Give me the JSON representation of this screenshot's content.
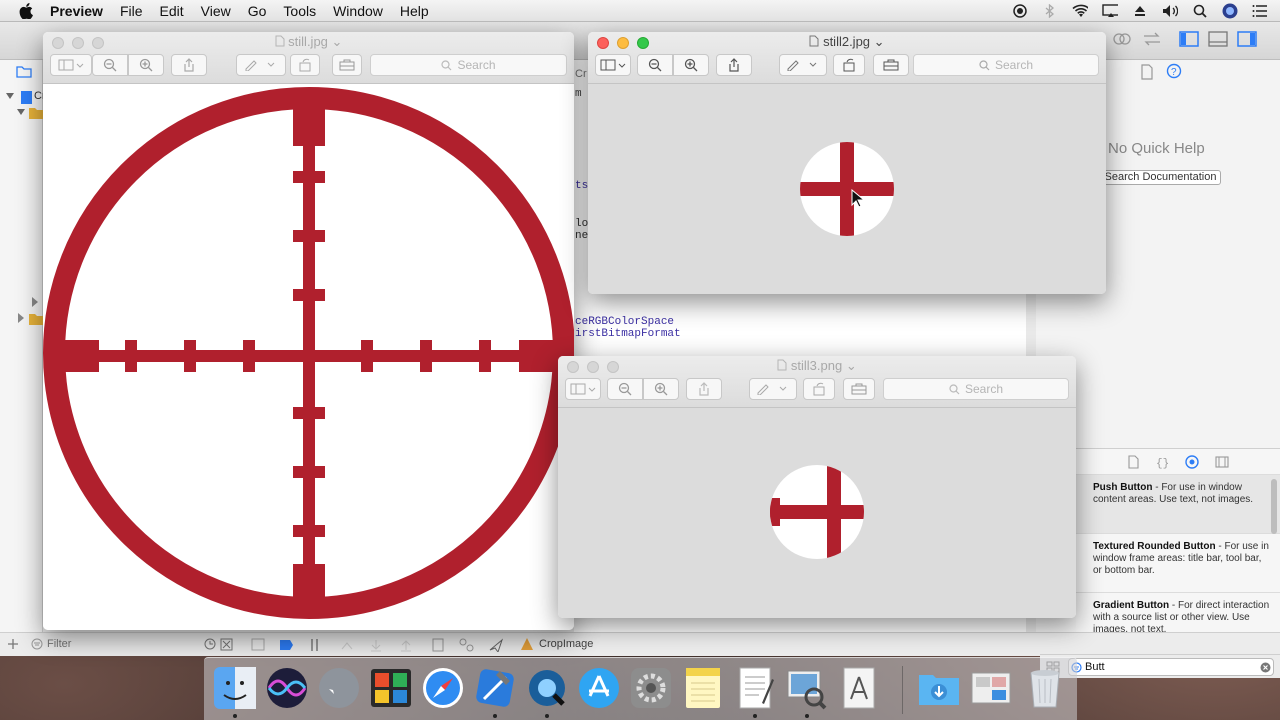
{
  "menubar": {
    "app_name": "Preview",
    "items": [
      "File",
      "Edit",
      "View",
      "Go",
      "Tools",
      "Window",
      "Help"
    ]
  },
  "xcode": {
    "code_fragments": [
      "tsu",
      "lo",
      "ne",
      "ceRGBColorSpace",
      "irstBitmapFormat",
      "m",
      "Cr",
      "Cr"
    ],
    "quick_help_title": "No Quick Help",
    "search_documentation_label": "Search Documentation",
    "bottom_filter_placeholder": "Filter",
    "scheme_label": "CropImage",
    "library_filter_value": "Butt",
    "library_items": [
      {
        "title": "Push Button",
        "desc": " - For use in window content areas. Use text, not images."
      },
      {
        "title": "Textured Rounded Button",
        "desc": " - For use in window frame areas: title bar, tool bar, or bottom bar."
      },
      {
        "title": "Gradient Button",
        "desc": " - For direct interaction with a source list or other view. Use images, not text."
      }
    ]
  },
  "windows": {
    "still": {
      "title": "still.jpg",
      "search_placeholder": "Search"
    },
    "still2": {
      "title": "still2.jpg",
      "search_placeholder": "Search"
    },
    "still3": {
      "title": "still3.png",
      "search_placeholder": "Search"
    }
  },
  "colors": {
    "crosshair_red": "#b0202d",
    "preview_gray": "#dcdcdc"
  },
  "dock": {
    "apps": [
      "finder-icon",
      "siri-icon",
      "launchpad-icon",
      "photo-booth-icon",
      "safari-icon",
      "xcode-icon",
      "quicktime-icon",
      "app-store-icon",
      "system-preferences-icon",
      "notes-icon",
      "textedit-icon",
      "preview-icon",
      "script-editor-icon",
      "downloads-folder-icon",
      "desktop-stack-icon",
      "trash-icon"
    ]
  }
}
